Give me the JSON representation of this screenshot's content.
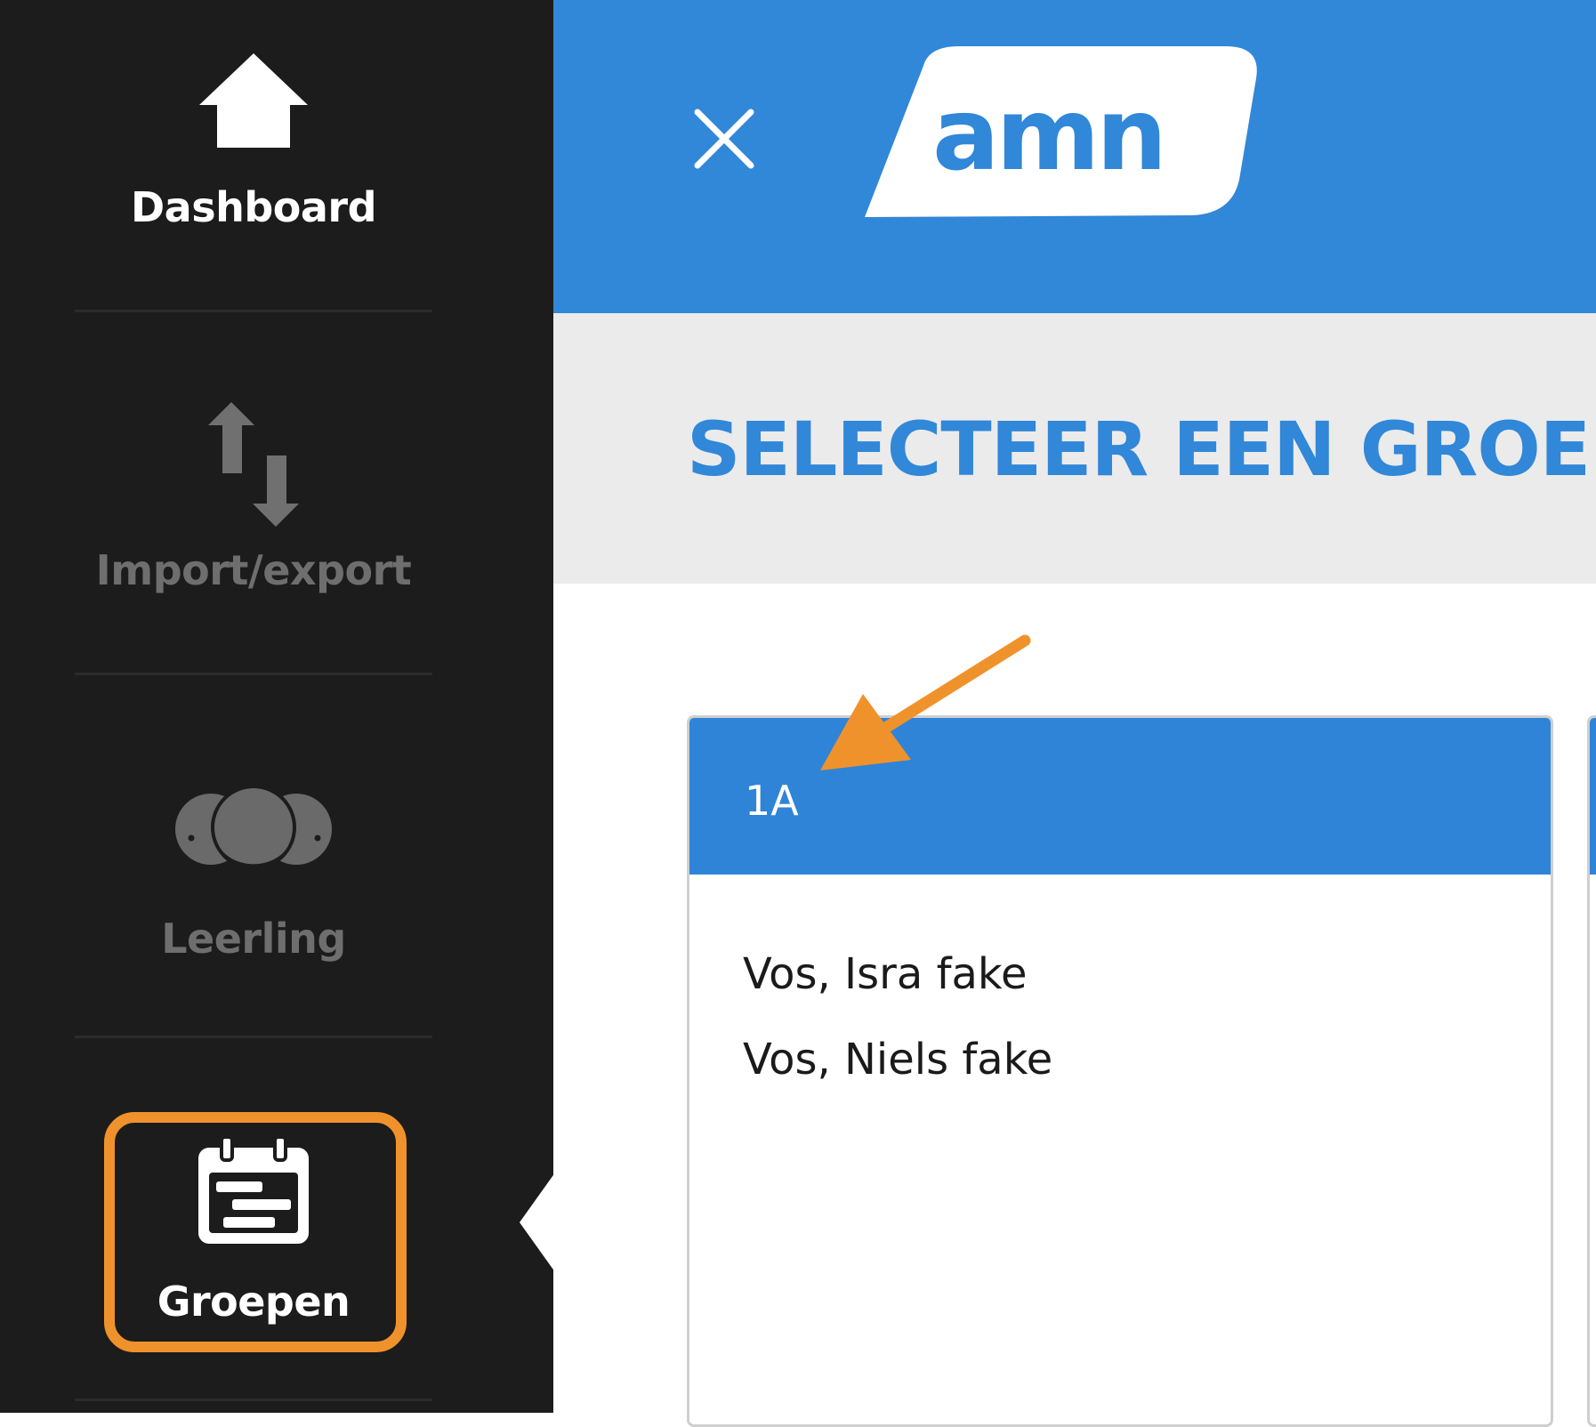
{
  "sidebar": {
    "items": [
      {
        "label": "Dashboard",
        "icon": "home-icon",
        "state": "active"
      },
      {
        "label": "Import/export",
        "icon": "import-export-icon",
        "state": "inactive"
      },
      {
        "label": "Leerling",
        "icon": "students-icon",
        "state": "inactive"
      },
      {
        "label": "Groepen",
        "icon": "calendar-icon",
        "state": "selected"
      }
    ]
  },
  "header": {
    "close_icon": "close-icon",
    "logo_text": "amn"
  },
  "page": {
    "title": "SELECTEER EEN GROEP"
  },
  "groups": [
    {
      "name": "1A",
      "members": [
        "Vos, Isra fake",
        "Vos, Niels fake"
      ]
    }
  ],
  "colors": {
    "sidebar_bg": "#1c1c1c",
    "brand_blue": "#3187d8",
    "title_band": "#ebebeb",
    "highlight_orange": "#f0922c",
    "inactive_text": "#6e6e6e"
  }
}
